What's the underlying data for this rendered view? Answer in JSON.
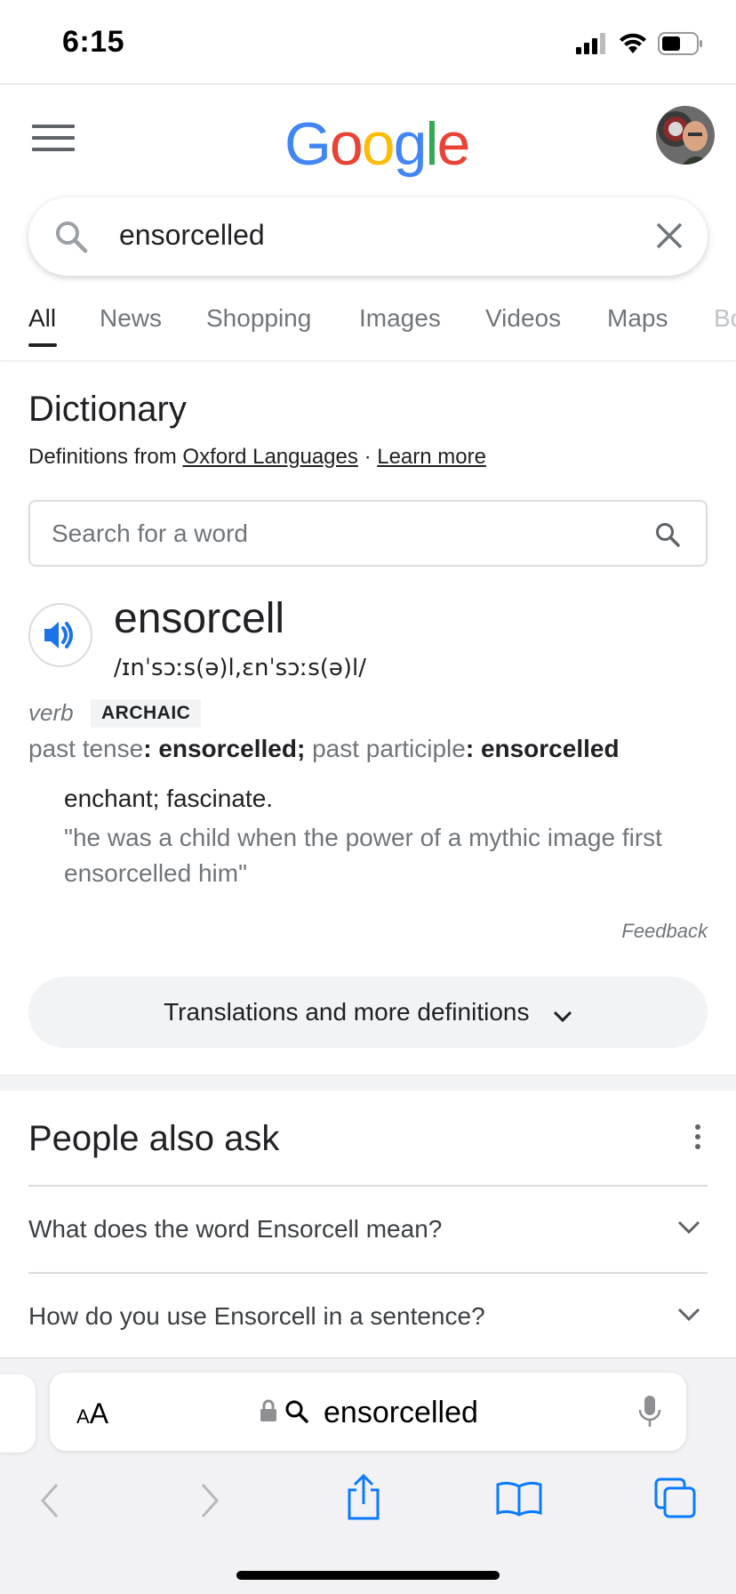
{
  "status_bar": {
    "time": "6:15"
  },
  "header": {
    "logo_text": "Google",
    "logo_colors": [
      "#4285F4",
      "#EA4335",
      "#FBBC05",
      "#4285F4",
      "#34A853",
      "#EA4335"
    ]
  },
  "search": {
    "query": "ensorcelled"
  },
  "tabs": [
    {
      "label": "All",
      "active": true
    },
    {
      "label": "News"
    },
    {
      "label": "Shopping"
    },
    {
      "label": "Images"
    },
    {
      "label": "Videos"
    },
    {
      "label": "Maps"
    },
    {
      "label": "Bo"
    }
  ],
  "dictionary": {
    "title": "Dictionary",
    "source_prefix": "Definitions from",
    "source_link": "Oxford Languages",
    "separator": "·",
    "learn_more": "Learn more",
    "word_search_placeholder": "Search for a word",
    "headword": "ensorcell",
    "phonetic": "/ɪnˈsɔːs(ə)l,ɛnˈsɔːs(ə)l/",
    "part_of_speech": "verb",
    "register": "ARCHAIC",
    "past_tense_label": "past tense",
    "past_tense": "ensorcelled",
    "past_participle_label": "past participle",
    "past_participle": "ensorcelled",
    "definition": "enchant; fascinate.",
    "example": "\"he was a child when the power of a mythic image first ensorcelled him\"",
    "feedback": "Feedback",
    "more_button": "Translations and more definitions"
  },
  "people_also_ask": {
    "title": "People also ask",
    "questions": [
      "What does the word Ensorcell mean?",
      "How do you use Ensorcell in a sentence?"
    ]
  },
  "safari": {
    "text_size_label_small": "A",
    "text_size_label_large": "A",
    "url": "ensorcelled"
  },
  "colors": {
    "accent_blue": "#1a73e8",
    "ios_blue": "#0a7aff"
  }
}
